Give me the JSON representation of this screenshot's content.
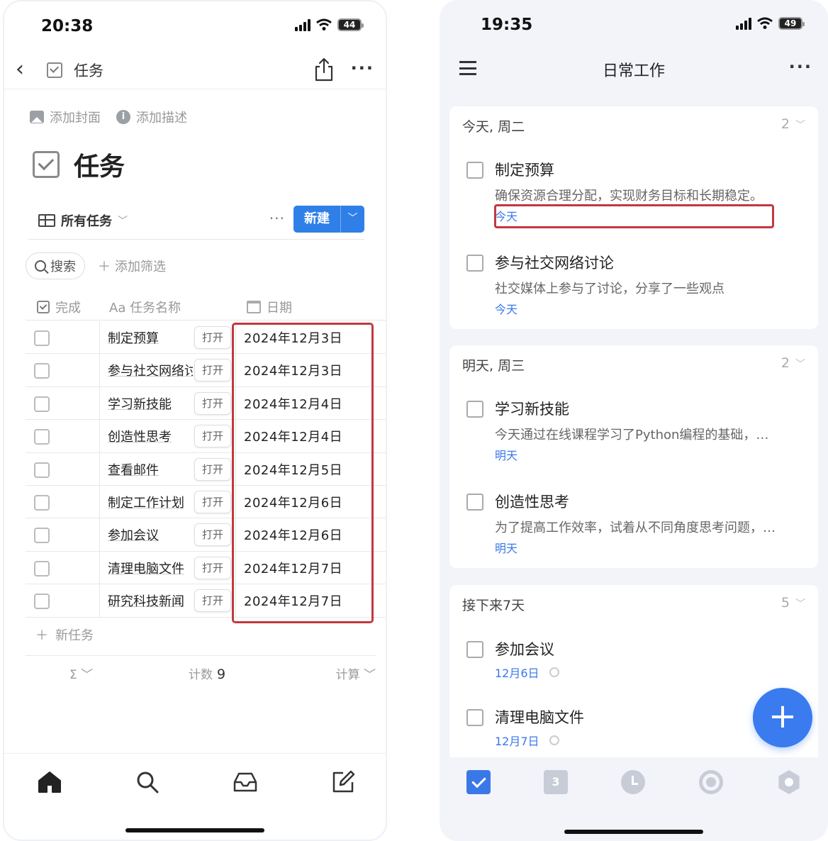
{
  "left_phone": {
    "status": {
      "time": "20:38",
      "battery": "44"
    },
    "nav": {
      "title": "任务"
    },
    "page_actions": {
      "add_cover": "添加封面",
      "add_description": "添加描述"
    },
    "page_title": "任务",
    "view": {
      "name": "所有任务",
      "new_label": "新建"
    },
    "filter": {
      "search": "搜索",
      "add_filter": "添加筛选"
    },
    "columns": {
      "done": "完成",
      "name": "Aa 任务名称",
      "date": "日期"
    },
    "open_label": "打开",
    "rows": [
      {
        "name": "制定预算",
        "date": "2024年12月3日"
      },
      {
        "name": "参与社交网络讨论",
        "date": "2024年12月3日"
      },
      {
        "name": "学习新技能",
        "date": "2024年12月4日"
      },
      {
        "name": "创造性思考",
        "date": "2024年12月4日"
      },
      {
        "name": "查看邮件",
        "date": "2024年12月5日"
      },
      {
        "name": "制定工作计划",
        "date": "2024年12月6日"
      },
      {
        "name": "参加会议",
        "date": "2024年12月6日"
      },
      {
        "name": "清理电脑文件",
        "date": "2024年12月7日"
      },
      {
        "name": "研究科技新闻",
        "date": "2024年12月7日"
      }
    ],
    "new_task": "新任务",
    "footer": {
      "sum_symbol": "Σ",
      "count_label": "计数",
      "count_value": "9",
      "calc_label": "计算"
    },
    "tabs": [
      "home-icon",
      "search-icon",
      "inbox-icon",
      "edit-icon"
    ]
  },
  "right_phone": {
    "status": {
      "time": "19:35",
      "battery": "49"
    },
    "nav": {
      "title": "日常工作"
    },
    "sections": [
      {
        "header": "今天, 周二",
        "count": "2",
        "tasks": [
          {
            "title": "制定预算",
            "desc": "确保资源合理分配，实现财务目标和长期稳定。",
            "date": "今天"
          },
          {
            "title": "参与社交网络讨论",
            "desc": "社交媒体上参与了讨论，分享了一些观点",
            "date": "今天"
          }
        ]
      },
      {
        "header": "明天, 周三",
        "count": "2",
        "tasks": [
          {
            "title": "学习新技能",
            "desc": "今天通过在线课程学习了Python编程的基础，…",
            "date": "明天"
          },
          {
            "title": "创造性思考",
            "desc": "为了提高工作效率，试着从不同角度思考问题，…",
            "date": "明天"
          }
        ]
      },
      {
        "header": "接下来7天",
        "count": "5",
        "tasks": [
          {
            "title": "参加会议",
            "date": "12月6日"
          },
          {
            "title": "清理电脑文件",
            "date": "12月7日"
          }
        ]
      }
    ],
    "calendar_tab_day": "3",
    "colors": {
      "accent": "#3a7bf0",
      "highlight": "#c0393f"
    }
  }
}
